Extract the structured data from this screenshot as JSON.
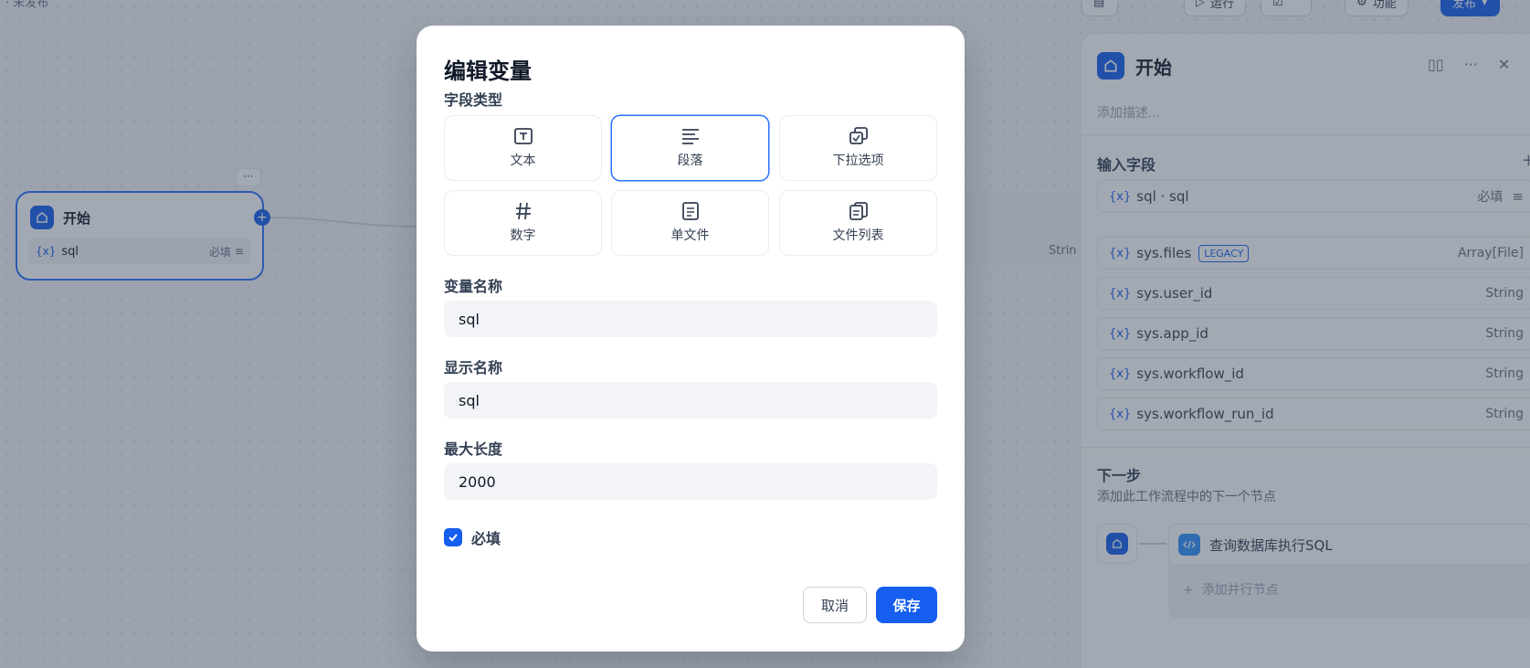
{
  "topbar": {
    "status": "· 未发布",
    "run_label": "运行",
    "features_label": "功能",
    "publish_label": "发布"
  },
  "canvas_node": {
    "title": "开始",
    "var_name": "sql",
    "required_label": "必填",
    "more": "···",
    "edge_type": "Strin"
  },
  "panel": {
    "title": "开始",
    "description_placeholder": "添加描述...",
    "input_section_title": "输入字段",
    "variables": [
      {
        "name": "sql · sql",
        "type": "必填"
      },
      {
        "name": "sys.files",
        "badge": "LEGACY",
        "type": "Array[File]"
      },
      {
        "name": "sys.user_id",
        "type": "String"
      },
      {
        "name": "sys.app_id",
        "type": "String"
      },
      {
        "name": "sys.workflow_id",
        "type": "String"
      },
      {
        "name": "sys.workflow_run_id",
        "type": "String"
      }
    ],
    "next_title": "下一步",
    "next_subtitle": "添加此工作流程中的下一个节点",
    "next_node_label": "查询数据库执行SQL",
    "add_parallel_label": "添加并行节点"
  },
  "modal": {
    "title": "编辑变量",
    "field_type_label": "字段类型",
    "types": [
      {
        "label": "文本",
        "icon": "text-icon"
      },
      {
        "label": "段落",
        "icon": "paragraph-icon",
        "selected": true
      },
      {
        "label": "下拉选项",
        "icon": "select-icon"
      },
      {
        "label": "数字",
        "icon": "number-icon"
      },
      {
        "label": "单文件",
        "icon": "file-icon"
      },
      {
        "label": "文件列表",
        "icon": "file-list-icon"
      }
    ],
    "var_name_label": "变量名称",
    "var_name_value": "sql",
    "display_name_label": "显示名称",
    "display_name_value": "sql",
    "max_length_label": "最大长度",
    "max_length_value": "2000",
    "required_label": "必填",
    "required_checked": true,
    "cancel_label": "取消",
    "save_label": "保存"
  },
  "colors": {
    "accent": "#155eef",
    "overlay": "#344054"
  }
}
